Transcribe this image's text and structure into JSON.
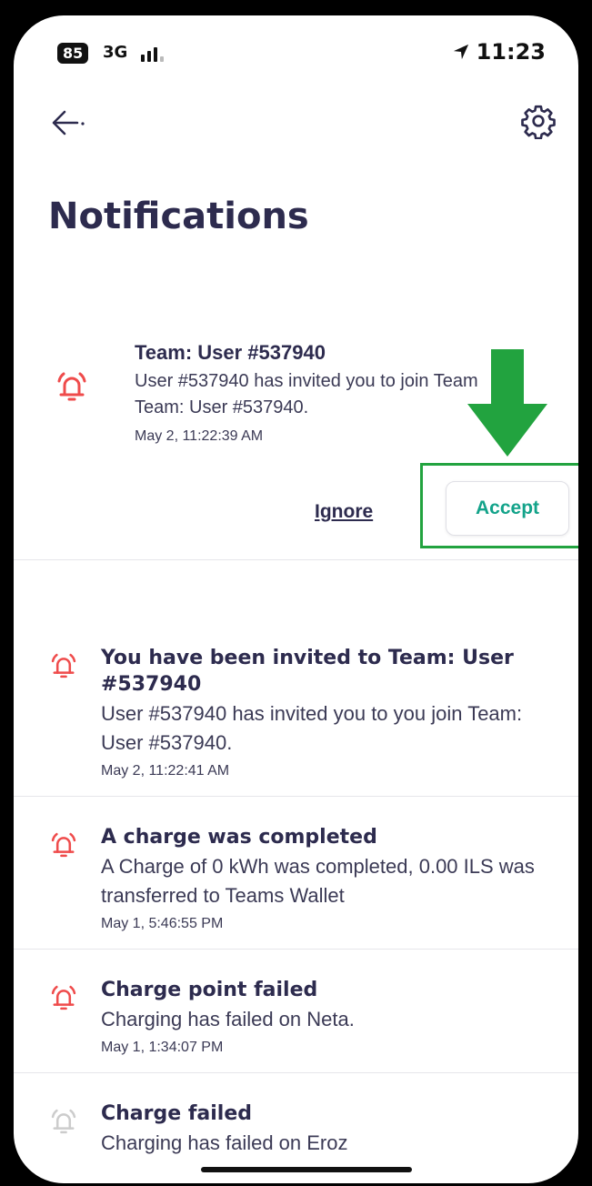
{
  "status_bar": {
    "battery": "85",
    "network": "3G",
    "time": "11:23"
  },
  "header": {
    "title": "Notifications"
  },
  "highlight": {
    "title": "Team: User #537940",
    "body": "User #537940 has invited you to join Team Team: User #537940.",
    "time": "May 2, 11:22:39 AM",
    "ignore_label": "Ignore",
    "accept_label": "Accept"
  },
  "notifications": [
    {
      "title": "You have been invited to Team: User #537940",
      "body": "User #537940 has invited you to you join Team: User #537940.",
      "time": "May 2, 11:22:41 AM"
    },
    {
      "title": "A charge was completed",
      "body": "A Charge of 0 kWh was completed, 0.00 ILS was transferred to Teams Wallet",
      "time": "May 1, 5:46:55 PM"
    },
    {
      "title": "Charge point failed",
      "body": "Charging has failed on Neta.",
      "time": "May 1, 1:34:07 PM"
    },
    {
      "title": "Charge failed",
      "body": "Charging has failed on Eroz"
    }
  ],
  "colors": {
    "accent": "#13a38a",
    "bell": "#ef4b4b",
    "highlight_frame": "#22a33f",
    "text": "#2d2b4e"
  }
}
